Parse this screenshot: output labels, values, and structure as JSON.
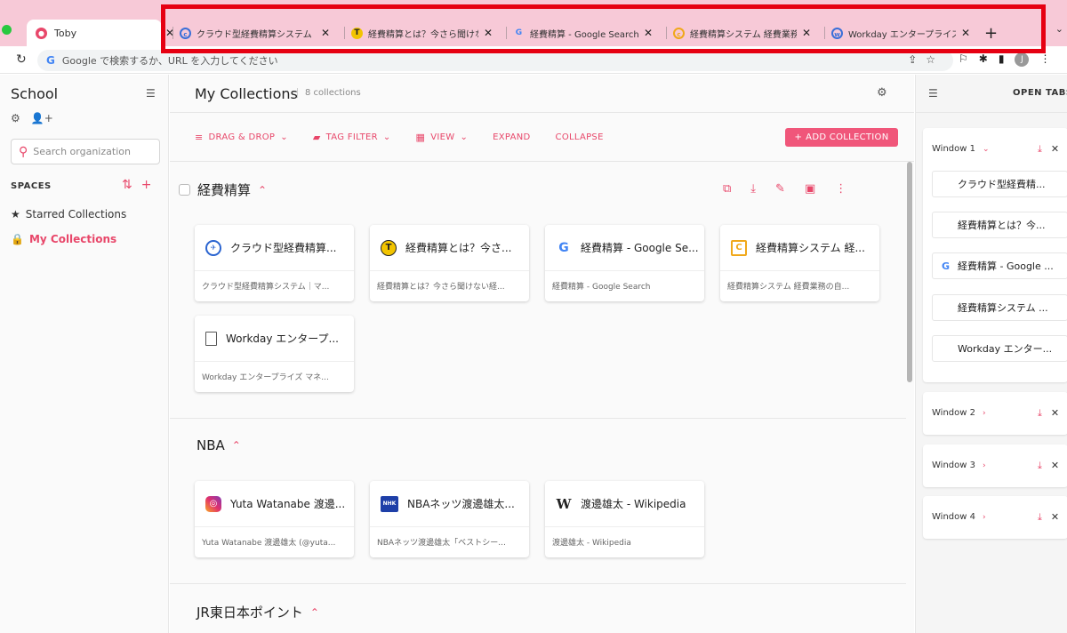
{
  "browser": {
    "active_tab": {
      "title": "Toby",
      "favicon": "toby-icon"
    },
    "tabs": [
      {
        "title": "クラウド型経費精算システム",
        "favicon": "cloud-icon",
        "color": "#3a6fd8"
      },
      {
        "title": "経費精算とは？今さら聞けな",
        "favicon": "t-icon",
        "color": "#f2c400"
      },
      {
        "title": "経費精算 - Google Search",
        "favicon": "google-icon",
        "color": "#4285f4"
      },
      {
        "title": "経費精算システム 経費業務",
        "favicon": "c-icon",
        "color": "#f0a81a"
      },
      {
        "title": "Workday エンタープライズ",
        "favicon": "workday-icon",
        "color": "#3a6fd8"
      }
    ],
    "omnibox_placeholder": "Google で検索するか、URL を入力してください",
    "profile_initial": "J"
  },
  "sidebar": {
    "org_title": "School",
    "search_placeholder": "Search organization",
    "spaces_label": "SPACES",
    "items": [
      {
        "label": "Starred Collections"
      },
      {
        "label": "My Collections"
      }
    ]
  },
  "main": {
    "title": "My Collections",
    "count": "8 collections",
    "toolbar": {
      "drag_drop": "DRAG & DROP",
      "tag_filter": "TAG FILTER",
      "view": "VIEW",
      "expand": "EXPAND",
      "collapse": "COLLAPSE",
      "add_collection": "ADD COLLECTION"
    },
    "accent": "#e8476a",
    "collections": [
      {
        "name": "経費精算",
        "cards": [
          {
            "title": "クラウド型経費精算...",
            "sub": "クラウド型経費精算システム｜マ...",
            "icon": "cloud-icon"
          },
          {
            "title": "経費精算とは？今さ...",
            "sub": "経費精算とは？今さら聞けない経...",
            "icon": "t-icon"
          },
          {
            "title": "経費精算 - Google Se...",
            "sub": "経費精算 - Google Search",
            "icon": "google-icon"
          },
          {
            "title": "経費精算システム 経...",
            "sub": "経費精算システム 経費業務の自...",
            "icon": "c-icon"
          },
          {
            "title": "Workday エンタープ...",
            "sub": "Workday エンタープライズ マネ...",
            "icon": "document-icon"
          }
        ]
      },
      {
        "name": "NBA",
        "cards": [
          {
            "title": "Yuta Watanabe 渡邊...",
            "sub": "Yuta Watanabe 渡邊雄太 (@yuta...",
            "icon": "instagram-icon"
          },
          {
            "title": "NBAネッツ渡邊雄太...",
            "sub": "NBAネッツ渡邊雄太「ベストシー...",
            "icon": "nhk-icon"
          },
          {
            "title": "渡邊雄太 - Wikipedia",
            "sub": "渡邊雄太 - Wikipedia",
            "icon": "wikipedia-icon"
          }
        ]
      },
      {
        "name": "JR東日本ポイント",
        "cards": []
      }
    ]
  },
  "right_panel": {
    "title": "OPEN TABS",
    "windows": [
      {
        "label": "Window 1",
        "expanded": true,
        "tabs": [
          {
            "title": "クラウド型経費精..."
          },
          {
            "title": "経費精算とは？今..."
          },
          {
            "title": "経費精算 - Google ..."
          },
          {
            "title": "経費精算システム ..."
          },
          {
            "title": "Workday エンター..."
          }
        ]
      },
      {
        "label": "Window 2",
        "expanded": false
      },
      {
        "label": "Window 3",
        "expanded": false
      },
      {
        "label": "Window 4",
        "expanded": false
      }
    ]
  }
}
